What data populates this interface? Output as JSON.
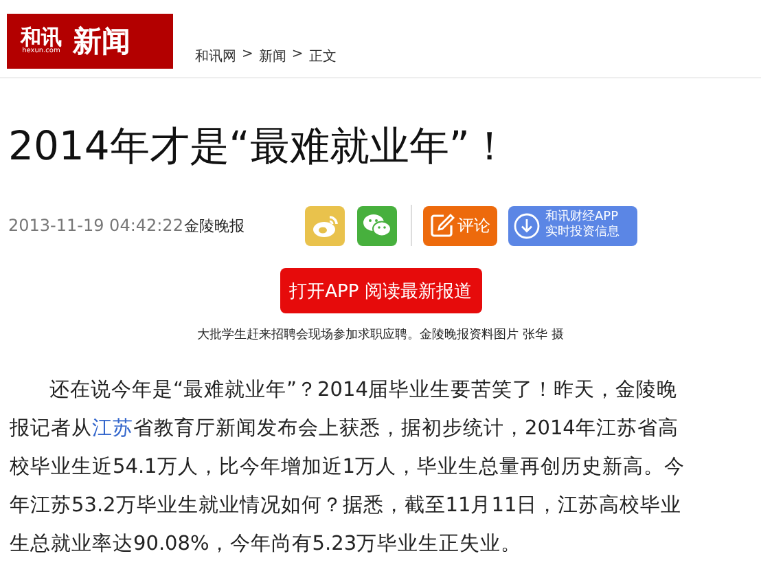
{
  "logo": {
    "brand": "和讯",
    "domain": "hexun.com",
    "section": "新闻"
  },
  "breadcrumb": [
    "和讯网",
    "新闻",
    "正文"
  ],
  "breadcrumb_separator": ">",
  "title": "2014年才是“最难就业年”！",
  "meta": {
    "datetime": "2013-11-19 04:42:22",
    "source": "金陵晚报"
  },
  "share": [
    {
      "kind": "weibo"
    },
    {
      "kind": "wechat"
    }
  ],
  "comment_button": "评论",
  "app_button": {
    "line_1": "和讯财经APP",
    "line_2": "实时投资信息"
  },
  "open_app_button": "打开APP 阅读最新报道",
  "caption": "大批学生赶来招聘会现场参加求职应聘。金陵晚报资料图片 张华 摄",
  "paragraph": {
    "lead": "还在说今年是“最难就业年”？2014届毕业生要苦笑了！昨天，金陵晚报记者从",
    "link": "江苏",
    "rest": "省教育厅新闻发布会上获悉，据初步统计，2014年江苏省高校毕业生近54.1万人，比今年增加近1万人，毕业生总量再创历史新高。今年江苏53.2万毕业生就业情况如何？据悉，截至11月11日，江苏高校毕业生总就业率达90.08%，今年尚有5.23万毕业生正失业。"
  }
}
